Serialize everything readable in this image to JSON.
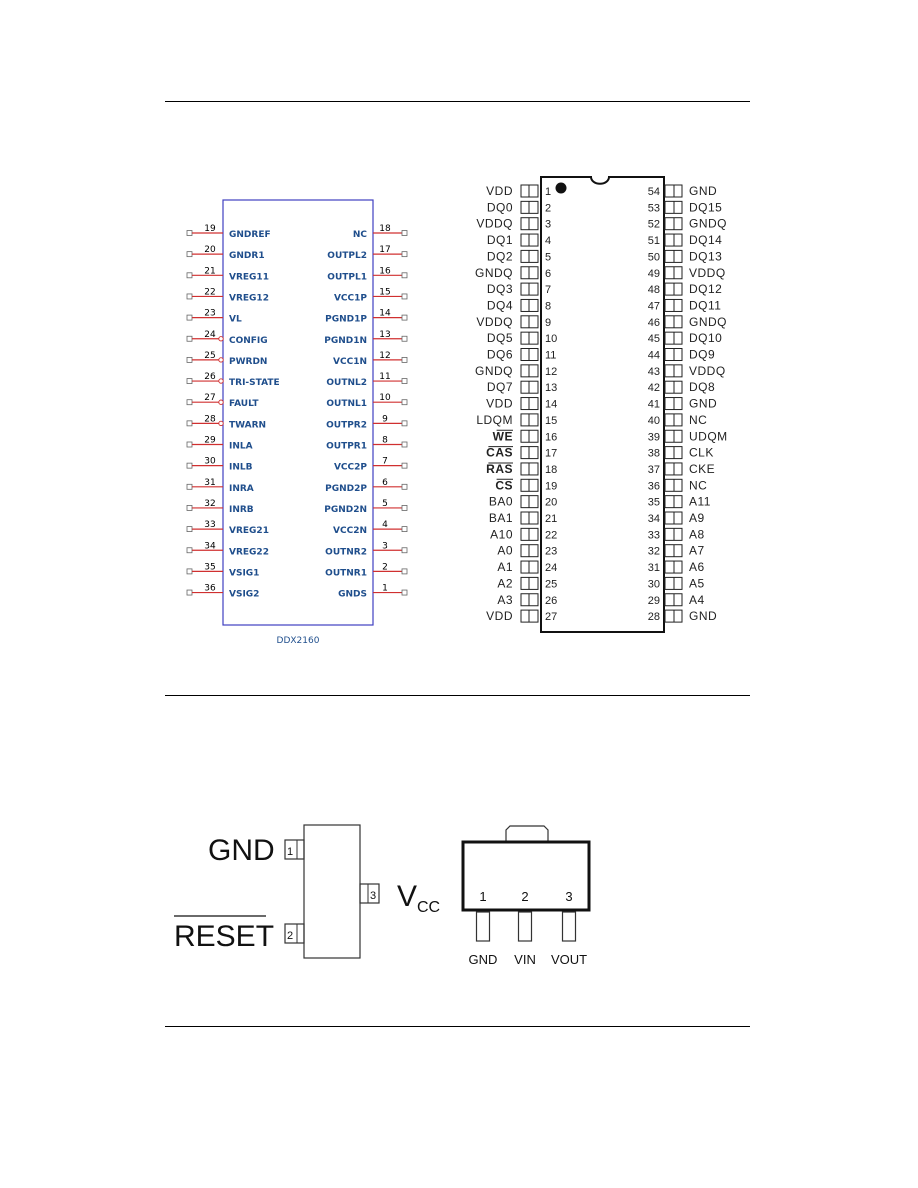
{
  "ddx": {
    "part_label": "DDX2160",
    "colors": {
      "body": "#4040c0",
      "pin": "#d03030",
      "text": "#1f4e8c"
    },
    "left_pins": [
      {
        "num": "19",
        "name": "GNDREF",
        "inverted": false
      },
      {
        "num": "20",
        "name": "GNDR1",
        "inverted": false
      },
      {
        "num": "21",
        "name": "VREG11",
        "inverted": false
      },
      {
        "num": "22",
        "name": "VREG12",
        "inverted": false
      },
      {
        "num": "23",
        "name": "VL",
        "inverted": false
      },
      {
        "num": "24",
        "name": "CONFIG",
        "inverted": true
      },
      {
        "num": "25",
        "name": "PWRDN",
        "inverted": true
      },
      {
        "num": "26",
        "name": "TRI-STATE",
        "inverted": true
      },
      {
        "num": "27",
        "name": "FAULT",
        "inverted": true
      },
      {
        "num": "28",
        "name": "TWARN",
        "inverted": true
      },
      {
        "num": "29",
        "name": "INLA",
        "inverted": false
      },
      {
        "num": "30",
        "name": "INLB",
        "inverted": false
      },
      {
        "num": "31",
        "name": "INRA",
        "inverted": false
      },
      {
        "num": "32",
        "name": "INRB",
        "inverted": false
      },
      {
        "num": "33",
        "name": "VREG21",
        "inverted": false
      },
      {
        "num": "34",
        "name": "VREG22",
        "inverted": false
      },
      {
        "num": "35",
        "name": "VSIG1",
        "inverted": false
      },
      {
        "num": "36",
        "name": "VSIG2",
        "inverted": false
      }
    ],
    "right_pins": [
      {
        "num": "18",
        "name": "NC"
      },
      {
        "num": "17",
        "name": "OUTPL2"
      },
      {
        "num": "16",
        "name": "OUTPL1"
      },
      {
        "num": "15",
        "name": "VCC1P"
      },
      {
        "num": "14",
        "name": "PGND1P"
      },
      {
        "num": "13",
        "name": "PGND1N"
      },
      {
        "num": "12",
        "name": "VCC1N"
      },
      {
        "num": "11",
        "name": "OUTNL2"
      },
      {
        "num": "10",
        "name": "OUTNL1"
      },
      {
        "num": "9",
        "name": "OUTPR2"
      },
      {
        "num": "8",
        "name": "OUTPR1"
      },
      {
        "num": "7",
        "name": "VCC2P"
      },
      {
        "num": "6",
        "name": "PGND2P"
      },
      {
        "num": "5",
        "name": "PGND2N"
      },
      {
        "num": "4",
        "name": "VCC2N"
      },
      {
        "num": "3",
        "name": "OUTNR2"
      },
      {
        "num": "2",
        "name": "OUTNR1"
      },
      {
        "num": "1",
        "name": "GNDS"
      }
    ]
  },
  "sdram": {
    "left_pins": [
      {
        "num": "1",
        "name": "VDD",
        "overbar": false
      },
      {
        "num": "2",
        "name": "DQ0",
        "overbar": false
      },
      {
        "num": "3",
        "name": "VDDQ",
        "overbar": false
      },
      {
        "num": "4",
        "name": "DQ1",
        "overbar": false
      },
      {
        "num": "5",
        "name": "DQ2",
        "overbar": false
      },
      {
        "num": "6",
        "name": "GNDQ",
        "overbar": false
      },
      {
        "num": "7",
        "name": "DQ3",
        "overbar": false
      },
      {
        "num": "8",
        "name": "DQ4",
        "overbar": false
      },
      {
        "num": "9",
        "name": "VDDQ",
        "overbar": false
      },
      {
        "num": "10",
        "name": "DQ5",
        "overbar": false
      },
      {
        "num": "11",
        "name": "DQ6",
        "overbar": false
      },
      {
        "num": "12",
        "name": "GNDQ",
        "overbar": false
      },
      {
        "num": "13",
        "name": "DQ7",
        "overbar": false
      },
      {
        "num": "14",
        "name": "VDD",
        "overbar": false
      },
      {
        "num": "15",
        "name": "LDQM",
        "overbar": false
      },
      {
        "num": "16",
        "name": "WE",
        "overbar": true
      },
      {
        "num": "17",
        "name": "CAS",
        "overbar": true
      },
      {
        "num": "18",
        "name": "RAS",
        "overbar": true
      },
      {
        "num": "19",
        "name": "CS",
        "overbar": true
      },
      {
        "num": "20",
        "name": "BA0",
        "overbar": false
      },
      {
        "num": "21",
        "name": "BA1",
        "overbar": false
      },
      {
        "num": "22",
        "name": "A10",
        "overbar": false
      },
      {
        "num": "23",
        "name": "A0",
        "overbar": false
      },
      {
        "num": "24",
        "name": "A1",
        "overbar": false
      },
      {
        "num": "25",
        "name": "A2",
        "overbar": false
      },
      {
        "num": "26",
        "name": "A3",
        "overbar": false
      },
      {
        "num": "27",
        "name": "VDD",
        "overbar": false
      }
    ],
    "right_pins": [
      {
        "num": "54",
        "name": "GND"
      },
      {
        "num": "53",
        "name": "DQ15"
      },
      {
        "num": "52",
        "name": "GNDQ"
      },
      {
        "num": "51",
        "name": "DQ14"
      },
      {
        "num": "50",
        "name": "DQ13"
      },
      {
        "num": "49",
        "name": "VDDQ"
      },
      {
        "num": "48",
        "name": "DQ12"
      },
      {
        "num": "47",
        "name": "DQ11"
      },
      {
        "num": "46",
        "name": "GNDQ"
      },
      {
        "num": "45",
        "name": "DQ10"
      },
      {
        "num": "44",
        "name": "DQ9"
      },
      {
        "num": "43",
        "name": "VDDQ"
      },
      {
        "num": "42",
        "name": "DQ8"
      },
      {
        "num": "41",
        "name": "GND"
      },
      {
        "num": "40",
        "name": "NC"
      },
      {
        "num": "39",
        "name": "UDQM"
      },
      {
        "num": "38",
        "name": "CLK"
      },
      {
        "num": "37",
        "name": "CKE"
      },
      {
        "num": "36",
        "name": "NC"
      },
      {
        "num": "35",
        "name": "A11"
      },
      {
        "num": "34",
        "name": "A9"
      },
      {
        "num": "33",
        "name": "A8"
      },
      {
        "num": "32",
        "name": "A7"
      },
      {
        "num": "31",
        "name": "A6"
      },
      {
        "num": "30",
        "name": "A5"
      },
      {
        "num": "29",
        "name": "A4"
      },
      {
        "num": "28",
        "name": "GND"
      }
    ]
  },
  "reset_ic": {
    "pin1": {
      "num": "1",
      "name": "GND"
    },
    "pin2": {
      "num": "2",
      "name": "RESET"
    },
    "pin3": {
      "num": "3",
      "name": "V",
      "sub": "CC"
    }
  },
  "regulator": {
    "pins": [
      {
        "num": "1",
        "name": "GND"
      },
      {
        "num": "2",
        "name": "VIN"
      },
      {
        "num": "3",
        "name": "VOUT"
      }
    ]
  }
}
